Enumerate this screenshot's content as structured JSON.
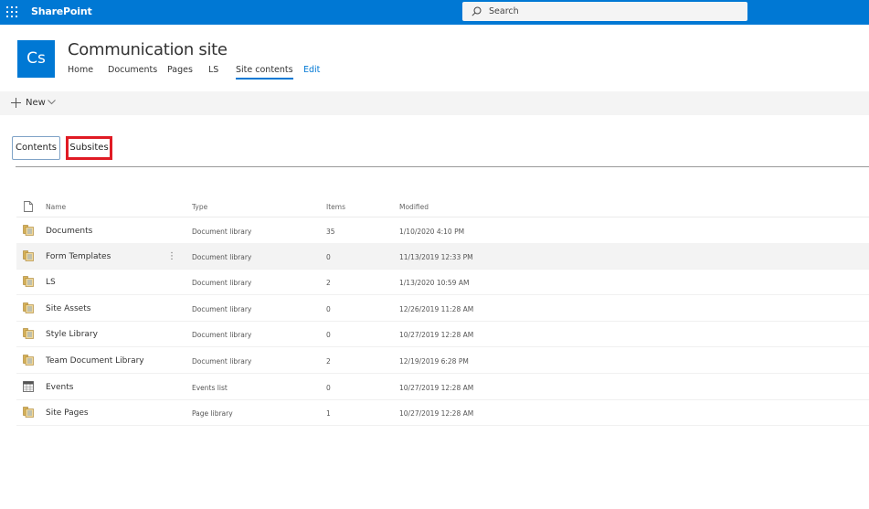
{
  "suite": {
    "brand": "SharePoint",
    "search_placeholder": "Search"
  },
  "site": {
    "logo_text": "Cs",
    "title": "Communication site",
    "nav": [
      "Home",
      "Documents",
      "Pages",
      "LS",
      "Site contents"
    ],
    "edit_label": "Edit",
    "active_nav": "Site contents"
  },
  "command_bar": {
    "new_label": "New"
  },
  "pivots": {
    "contents": "Contents",
    "subsites": "Subsites"
  },
  "table": {
    "headers": {
      "name": "Name",
      "type": "Type",
      "items": "Items",
      "modified": "Modified"
    },
    "rows": [
      {
        "name": "Documents",
        "type": "Document library",
        "items": "35",
        "modified": "1/10/2020 4:10 PM",
        "icon": "library-icon"
      },
      {
        "name": "Form Templates",
        "type": "Document library",
        "items": "0",
        "modified": "11/13/2019 12:33 PM",
        "icon": "library-icon"
      },
      {
        "name": "LS",
        "type": "Document library",
        "items": "2",
        "modified": "1/13/2020 10:59 AM",
        "icon": "library-icon"
      },
      {
        "name": "Site Assets",
        "type": "Document library",
        "items": "0",
        "modified": "12/26/2019 11:28 AM",
        "icon": "library-icon"
      },
      {
        "name": "Style Library",
        "type": "Document library",
        "items": "0",
        "modified": "10/27/2019 12:28 AM",
        "icon": "library-icon"
      },
      {
        "name": "Team Document Library",
        "type": "Document library",
        "items": "2",
        "modified": "12/19/2019 6:28 PM",
        "icon": "library-icon"
      },
      {
        "name": "Events",
        "type": "Events list",
        "items": "0",
        "modified": "10/27/2019 12:28 AM",
        "icon": "calendar-icon"
      },
      {
        "name": "Site Pages",
        "type": "Page library",
        "items": "1",
        "modified": "10/27/2019 12:28 AM",
        "icon": "library-icon"
      }
    ]
  },
  "colors": {
    "suite_bar": "#0078d4",
    "accent": "#0078d4",
    "highlight_box": "#e01b24",
    "hover_row": "#f3f3f3"
  }
}
